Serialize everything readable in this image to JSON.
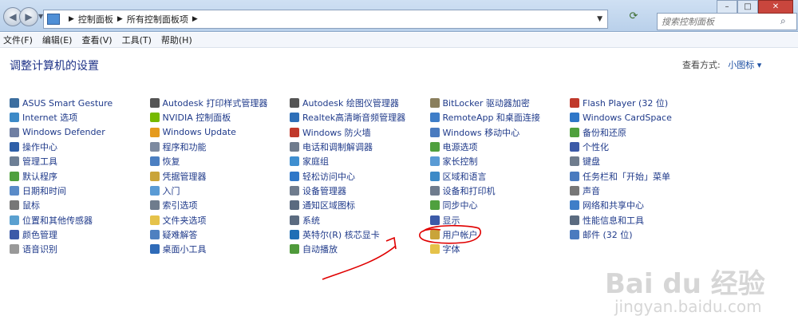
{
  "window": {
    "breadcrumbs": [
      "控制面板",
      "所有控制面板项"
    ],
    "search_placeholder": "搜索控制面板"
  },
  "menubar": [
    "文件(F)",
    "编辑(E)",
    "查看(V)",
    "工具(T)",
    "帮助(H)"
  ],
  "header": {
    "title": "调整计算机的设置",
    "view_by_label": "查看方式:",
    "view_by_value": "小图标 ▾"
  },
  "columns": [
    [
      {
        "label": "ASUS Smart Gesture",
        "color": "#3c6e9f"
      },
      {
        "label": "Internet 选项",
        "color": "#3d8ac7"
      },
      {
        "label": "Windows Defender",
        "color": "#6f7fa3"
      },
      {
        "label": "操作中心",
        "color": "#2e5fa8"
      },
      {
        "label": "管理工具",
        "color": "#6d7f95"
      },
      {
        "label": "默认程序",
        "color": "#4fa03e"
      },
      {
        "label": "日期和时间",
        "color": "#5a8bc8"
      },
      {
        "label": "鼠标",
        "color": "#777777"
      },
      {
        "label": "位置和其他传感器",
        "color": "#5aa0d0"
      },
      {
        "label": "颜色管理",
        "color": "#3c5aa8"
      },
      {
        "label": "语音识别",
        "color": "#999999"
      }
    ],
    [
      {
        "label": "Autodesk 打印样式管理器",
        "color": "#555555"
      },
      {
        "label": "NVIDIA 控制面板",
        "color": "#76b900"
      },
      {
        "label": "Windows Update",
        "color": "#e59b1e"
      },
      {
        "label": "程序和功能",
        "color": "#7d8aa0"
      },
      {
        "label": "恢复",
        "color": "#4b7fc1"
      },
      {
        "label": "凭据管理器",
        "color": "#c9a43a"
      },
      {
        "label": "入门",
        "color": "#5a9bd5"
      },
      {
        "label": "索引选项",
        "color": "#6f7c8d"
      },
      {
        "label": "文件夹选项",
        "color": "#e5c24a"
      },
      {
        "label": "疑难解答",
        "color": "#4f80c0"
      },
      {
        "label": "桌面小工具",
        "color": "#2f6bb8"
      }
    ],
    [
      {
        "label": "Autodesk 绘图仪管理器",
        "color": "#555555"
      },
      {
        "label": "Realtek高清晰音频管理器",
        "color": "#2e6fb8"
      },
      {
        "label": "Windows 防火墙",
        "color": "#c0392b"
      },
      {
        "label": "电话和调制解调器",
        "color": "#6f7c8d"
      },
      {
        "label": "家庭组",
        "color": "#3f8fd0"
      },
      {
        "label": "轻松访问中心",
        "color": "#2f77c8"
      },
      {
        "label": "设备管理器",
        "color": "#6f7c8d"
      },
      {
        "label": "通知区域图标",
        "color": "#5b6b80"
      },
      {
        "label": "系统",
        "color": "#5b6b80"
      },
      {
        "label": "英特尔(R) 核芯显卡",
        "color": "#1f6fb5"
      },
      {
        "label": "自动播放",
        "color": "#4f9a3b"
      }
    ],
    [
      {
        "label": "BitLocker 驱动器加密",
        "color": "#8a7f5d"
      },
      {
        "label": "RemoteApp 和桌面连接",
        "color": "#3f7ec8"
      },
      {
        "label": "Windows 移动中心",
        "color": "#4a7bbf"
      },
      {
        "label": "电源选项",
        "color": "#4fa03e"
      },
      {
        "label": "家长控制",
        "color": "#5a9bd5"
      },
      {
        "label": "区域和语言",
        "color": "#3d8ac7"
      },
      {
        "label": "设备和打印机",
        "color": "#6f7c8d"
      },
      {
        "label": "同步中心",
        "color": "#4fa03e"
      },
      {
        "label": "显示",
        "color": "#3c5aa8"
      },
      {
        "label": "用户帐户",
        "color": "#c9a43a"
      },
      {
        "label": "字体",
        "color": "#e5c24a"
      }
    ],
    [
      {
        "label": "Flash Player (32 位)",
        "color": "#c0392b"
      },
      {
        "label": "Windows CardSpace",
        "color": "#2f77c8"
      },
      {
        "label": "备份和还原",
        "color": "#4fa03e"
      },
      {
        "label": "个性化",
        "color": "#3c5aa8"
      },
      {
        "label": "键盘",
        "color": "#6f7c8d"
      },
      {
        "label": "任务栏和「开始」菜单",
        "color": "#4a7bbf"
      },
      {
        "label": "声音",
        "color": "#777777"
      },
      {
        "label": "网络和共享中心",
        "color": "#3f7ec8"
      },
      {
        "label": "性能信息和工具",
        "color": "#5b6b80"
      },
      {
        "label": "邮件 (32 位)",
        "color": "#4a7bbf"
      },
      {
        "label": "",
        "color": ""
      }
    ]
  ],
  "watermark": {
    "brand": "Bai du 经验",
    "url": "jingyan.baidu.com"
  },
  "colors": {
    "link": "#1f3a8a",
    "title": "#1e3287",
    "annotation": "#e00000"
  }
}
